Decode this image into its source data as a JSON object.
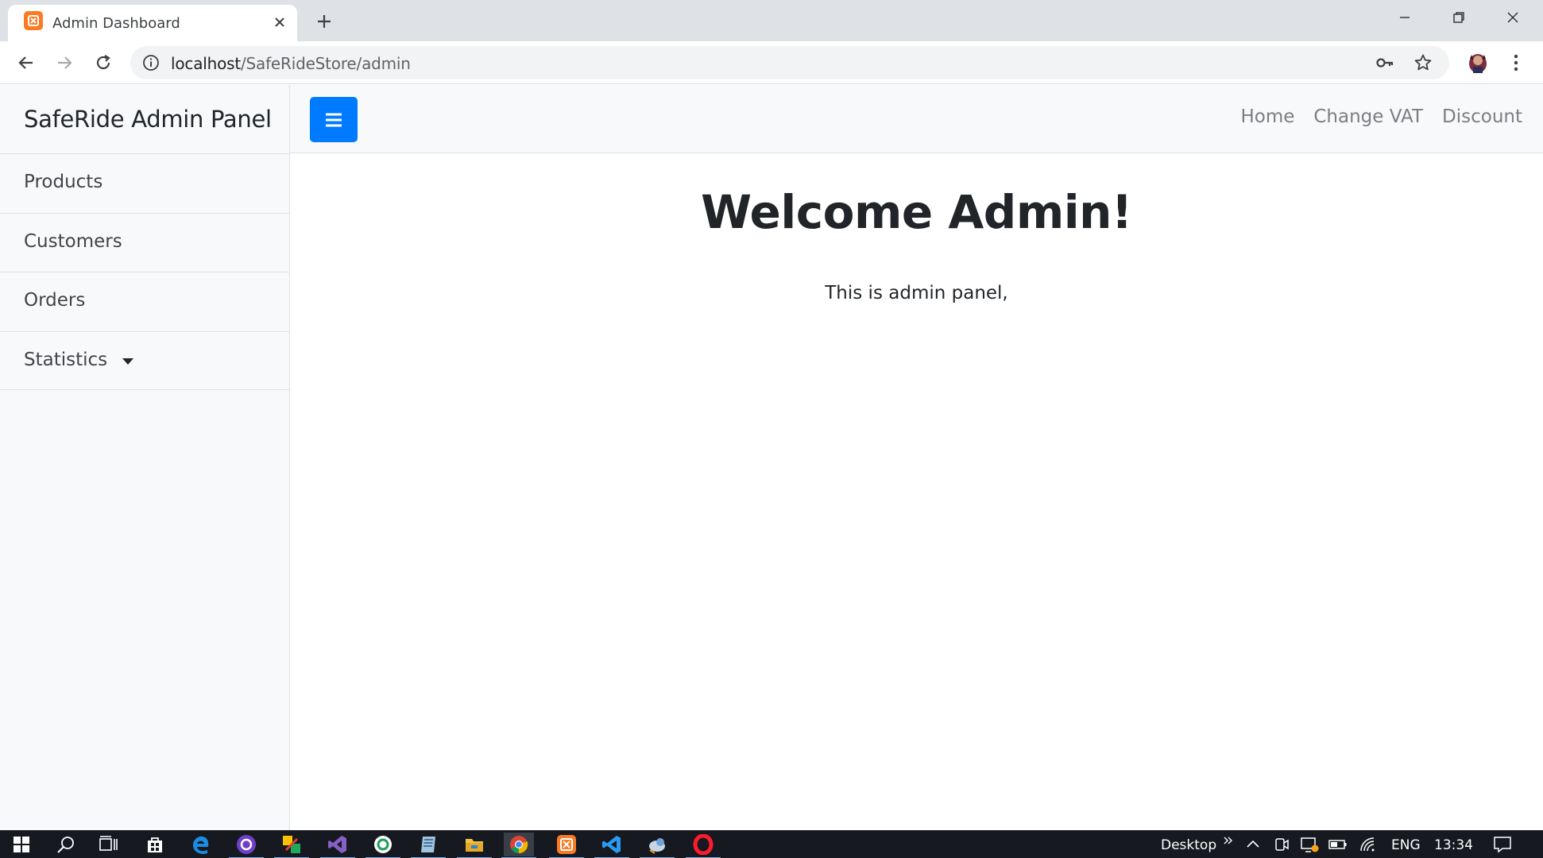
{
  "browser": {
    "tab_title": "Admin Dashboard",
    "url_host": "localhost",
    "url_path": "/SafeRideStore/admin",
    "icons": [
      "xampp-favicon-icon",
      "close-icon",
      "plus-icon",
      "minimize-icon",
      "restore-icon",
      "window-close-icon",
      "back-arrow-icon",
      "forward-arrow-icon",
      "reload-icon",
      "info-icon",
      "key-icon",
      "star-icon",
      "profile-avatar-icon",
      "more-vert-icon"
    ]
  },
  "sidebar": {
    "brand": "SafeRide Admin Panel",
    "items": [
      {
        "label": "Products"
      },
      {
        "label": "Customers"
      },
      {
        "label": "Orders"
      },
      {
        "label": "Statistics"
      }
    ]
  },
  "topnav": {
    "links": [
      {
        "label": "Home"
      },
      {
        "label": "Change VAT"
      },
      {
        "label": "Discount"
      }
    ]
  },
  "main": {
    "heading": "Welcome Admin!",
    "text": "This is admin panel,"
  },
  "taskbar": {
    "desktop_label": "Desktop",
    "language": "ENG",
    "time": "13:34"
  },
  "colors": {
    "primary": "#007bff",
    "sidebar_bg": "#f8f9fa",
    "taskbar_bg": "#16191f",
    "tabstrip_bg": "#dee1e6"
  }
}
